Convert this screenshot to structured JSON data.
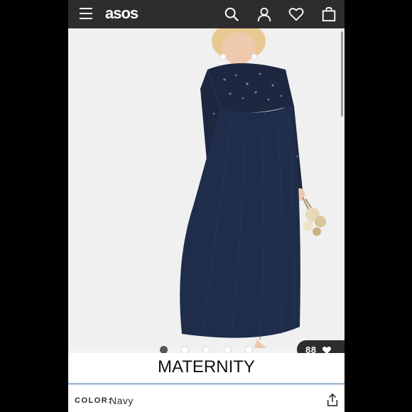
{
  "header": {
    "logo": "asos",
    "icons": [
      "menu-icon",
      "search-icon",
      "account-icon",
      "heart-icon",
      "bag-icon"
    ]
  },
  "product": {
    "image_alt": "Navy sequin maternity maxi dress",
    "carousel": {
      "total": 5,
      "active": 1
    },
    "favorites_count": "88",
    "banner": "MATERNITY",
    "color_label": "COLOR:",
    "color_value": "Navy"
  },
  "colors": {
    "topbar": "#2d2d2d",
    "dress": "#1f2d4a",
    "accent_line": "#3a6fb2"
  }
}
